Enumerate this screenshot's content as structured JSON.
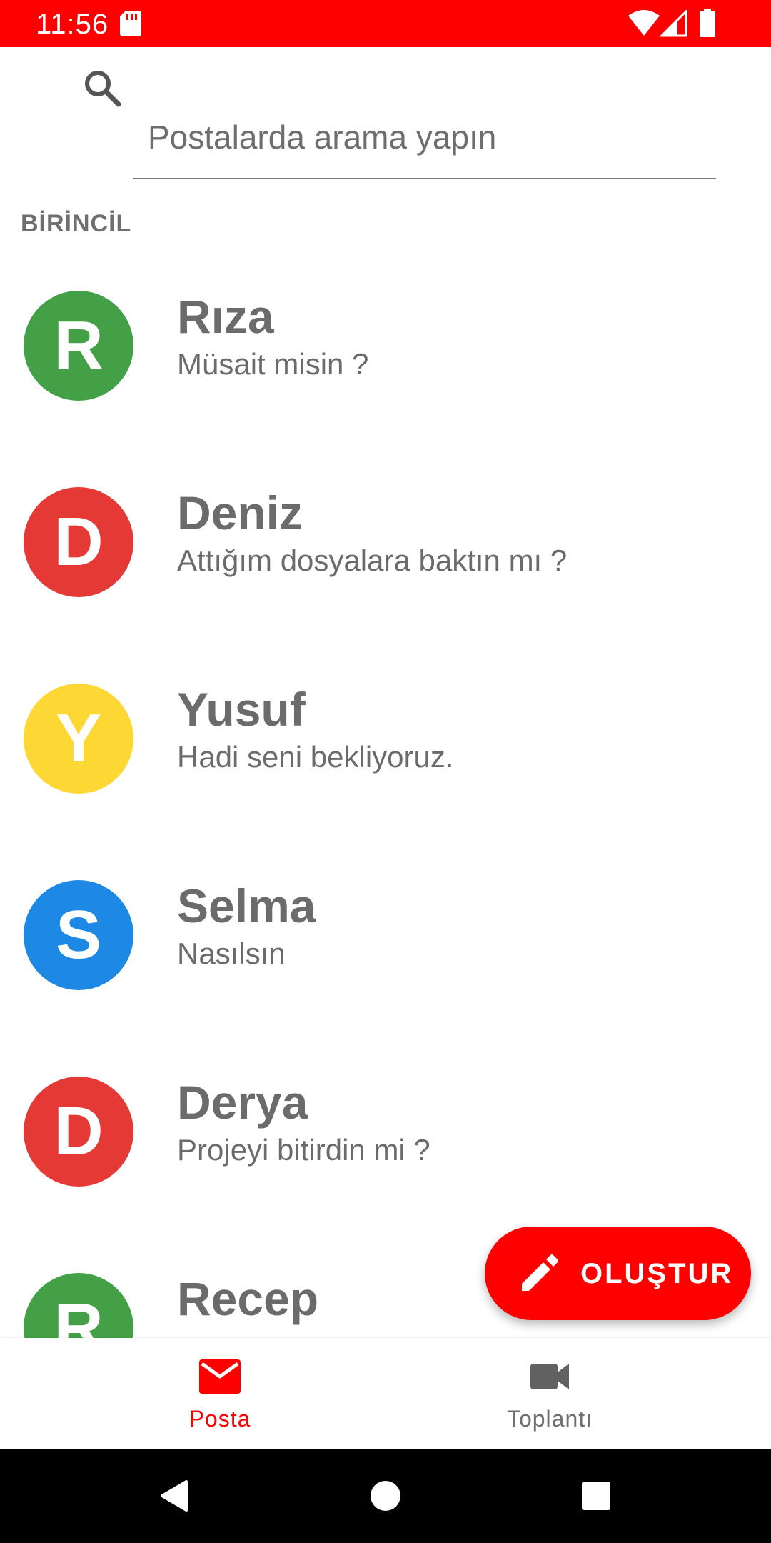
{
  "status_bar": {
    "time": "11:56",
    "color": "#ff0000"
  },
  "search": {
    "placeholder": "Postalarda arama yapın",
    "value": ""
  },
  "section": {
    "label": "BİRİNCİL"
  },
  "mails": [
    {
      "sender": "Rıza",
      "snippet": "Müsait misin ?",
      "avatar_letter": "R",
      "avatar_color": "#43a047"
    },
    {
      "sender": "Deniz",
      "snippet": "Attığım dosyalara baktın mı ?",
      "avatar_letter": "D",
      "avatar_color": "#e53935"
    },
    {
      "sender": "Yusuf",
      "snippet": "Hadi seni bekliyoruz.",
      "avatar_letter": "Y",
      "avatar_color": "#fdd835"
    },
    {
      "sender": "Selma",
      "snippet": "Nasılsın",
      "avatar_letter": "S",
      "avatar_color": "#1e88e5"
    },
    {
      "sender": "Derya",
      "snippet": "Projeyi bitirdin mi ?",
      "avatar_letter": "D",
      "avatar_color": "#e53935"
    },
    {
      "sender": "Recep",
      "snippet": "",
      "avatar_letter": "R",
      "avatar_color": "#43a047"
    }
  ],
  "fab": {
    "label": "OLUŞTUR",
    "icon": "pencil-icon",
    "color": "#ff0000"
  },
  "bottom_nav": {
    "items": [
      {
        "label": "Posta",
        "icon": "mail-icon",
        "active": true
      },
      {
        "label": "Toplantı",
        "icon": "video-icon",
        "active": false
      }
    ],
    "active_color": "#ff0000",
    "inactive_color": "#616161"
  },
  "system_nav": {
    "buttons": [
      "back-icon",
      "home-icon",
      "recents-icon"
    ]
  }
}
